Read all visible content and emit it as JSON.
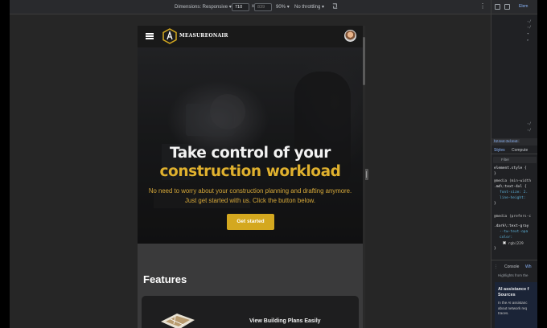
{
  "devtools_toolbar": {
    "dimensions_label": "Dimensions: Responsive",
    "width_value": "710",
    "times": "x",
    "height_value": "839",
    "zoom": "90%",
    "throttling": "No throttling"
  },
  "site": {
    "logo_text": "MEASUREONAIR",
    "hero": {
      "title_line1": "Take control of your",
      "title_line2": "construction workload",
      "subtitle_line1": "No need to worry about your construction planning and drafting anymore.",
      "subtitle_line2": "Just get started with us. Click the button below.",
      "cta_label": "Get started"
    },
    "features_heading": "Features",
    "feature_card_title": "View Building Plans Easily"
  },
  "devtools_panel": {
    "tab_elements": "Elem",
    "breadcrumb": "h2.text-3xl.text-",
    "subtab_styles": "Styles",
    "subtab_computed": "Compute",
    "filter_placeholder": "Filter",
    "element_style": "element.style {",
    "rule_media1": "@media (min-width",
    "rule_selector1": ".md\\:text-4xl {",
    "rule_prop1": "font-size: 2.",
    "rule_prop2": "line-height:",
    "rule_media2": "@media (prefers-c",
    "rule_selector2": ".dark\\:text-gray",
    "rule_prop3": "--tw-text-opa",
    "rule_prop4": "color:",
    "rule_prop5": "rgb(229",
    "drawer_console": "Console",
    "drawer_what": "Wh",
    "highlights": "Highlights from the",
    "ai_title_line1": "AI assistance f",
    "ai_title_line2": "Sources",
    "ai_body_line1": "In the AI assistanc",
    "ai_body_line2": "about network req",
    "ai_body_line3": "traces."
  },
  "colors": {
    "accent": "#d4a81f",
    "title_highlight": "#e0b12e",
    "subtitle": "#d7a93a"
  }
}
